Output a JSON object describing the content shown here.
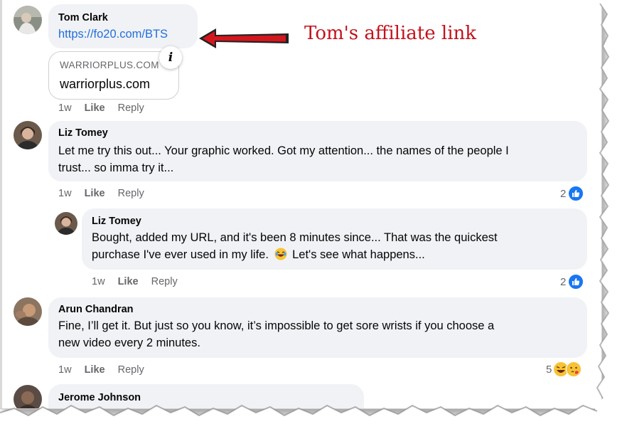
{
  "comments": [
    {
      "author": "Tom Clark",
      "link_text": "https://fo20.com/BTS",
      "preview": {
        "domain": "WARRIORPLUS.COM",
        "title": "warriorplus.com"
      },
      "time": "1w",
      "like_label": "Like",
      "reply_label": "Reply"
    },
    {
      "author": "Liz Tomey",
      "line1": "Let me try this out... Your graphic worked. Got my attention... the names of the people I",
      "line2": "trust... so imma try it...",
      "time": "1w",
      "like_label": "Like",
      "reply_label": "Reply",
      "reaction_count": "2"
    },
    {
      "author": "Liz Tomey",
      "line1": "Bought, added my URL, and it's been 8 minutes since... That was the quickest",
      "line2a": "purchase I've ever used in my life.",
      "line2b": "Let's see what happens...",
      "time": "1w",
      "like_label": "Like",
      "reply_label": "Reply",
      "reaction_count": "2"
    },
    {
      "author": "Arun Chandran",
      "line1": "Fine, I’ll get it. But just so you know, it’s impossible to get sore wrists if you choose a",
      "line2": "new video every 2 minutes.",
      "time": "1w",
      "like_label": "Like",
      "reply_label": "Reply",
      "reaction_count": "5"
    },
    {
      "author": "Jerome Johnson"
    }
  ],
  "annotation": {
    "text": "Tom's affiliate link",
    "color": "#c3121c"
  },
  "icons": {
    "info": "info-icon",
    "like_reaction": "thumbs-up-icon",
    "laugh_reaction": "laughing-emoji-icon",
    "love_reaction": "heart-kiss-emoji-icon",
    "laugh_emoji": "laughing-emoji-icon"
  },
  "colors": {
    "link": "#216fdb",
    "bubble": "#f0f2f5",
    "like_blue": "#1877f2",
    "meta": "#65676b"
  }
}
